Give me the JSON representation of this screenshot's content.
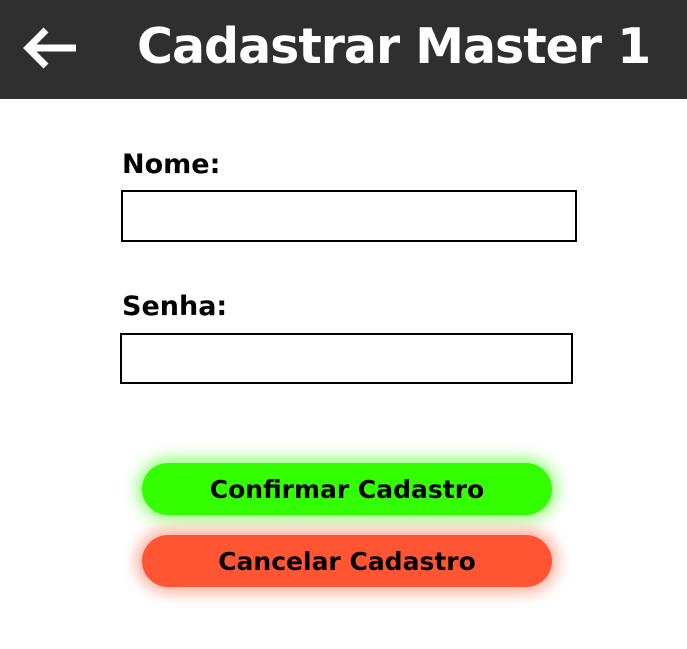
{
  "header": {
    "back_icon": "arrow-left-icon",
    "title": "Cadastrar Master 1",
    "background_color": "#2f2f2f"
  },
  "form": {
    "name_label": "Nome:",
    "name_value": "",
    "password_label": "Senha:",
    "password_value": ""
  },
  "actions": {
    "confirm_label": "Confirmar Cadastro",
    "confirm_color": "#33ff00",
    "cancel_label": "Cancelar Cadastro",
    "cancel_color": "#ff5533"
  }
}
